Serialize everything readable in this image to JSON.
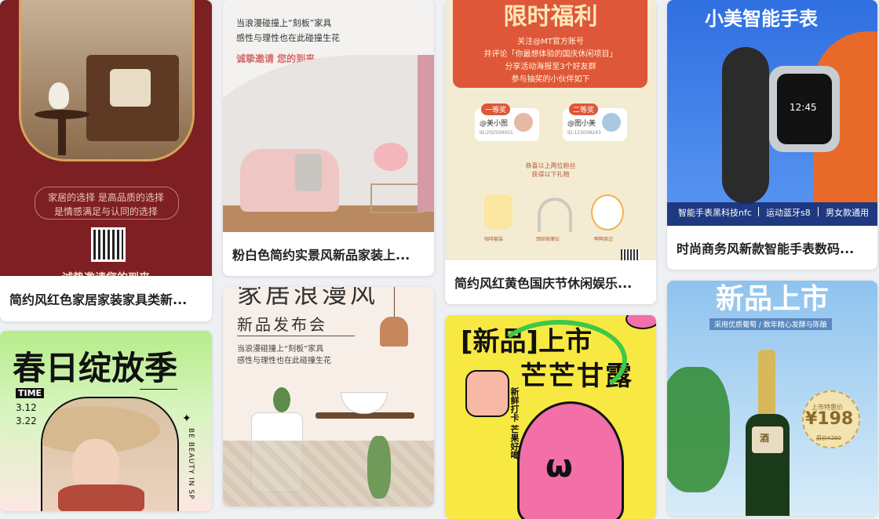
{
  "cards": [
    {
      "title": "简约风红色家居家装家具类新...",
      "lines": [
        "家居的选择 是高品质的选择",
        "是情感满足与认同的选择"
      ],
      "footer": "诚挚邀请您的到来"
    },
    {
      "title": "春日绽放季",
      "tag": "TIME",
      "dates": [
        "3.12",
        "3.22"
      ],
      "side": "BE BEAUTY IN SP"
    },
    {
      "title": "粉白色简约实景风新品家装上...",
      "lines": [
        "当浪漫碰撞上“刻板”家具",
        "感性与理性也在此碰撞生花"
      ],
      "invite": "诚挚邀请 您的到来"
    },
    {
      "heading": "家居浪漫风",
      "sub": "新品发布会",
      "lines": [
        "当浪漫碰撞上“刻板”家具",
        "感性与理性也在此碰撞生花"
      ]
    },
    {
      "title": "简约风红黄色国庆节休闲娱乐...",
      "heading": "限时福利",
      "rules": [
        "关注@MT官方账号",
        "并评论「你最想体验的国庆休闲项目」",
        "分享活动海报至3个好友群",
        "参与抽奖的小伙伴如下"
      ],
      "prize1": "一等奖",
      "prize2": "二等奖",
      "winner1": "@美小图",
      "winner2": "@图小美",
      "id1": "ID:202509001",
      "id2": "ID:123008243",
      "congrats": [
        "恭喜以上两位粉丝",
        "获得以下礼物"
      ],
      "gifts": [
        "咖啡套装",
        "颈部按摩仪",
        "鸭鸭周边"
      ]
    },
    {
      "heading1": "[新品]上市",
      "heading2": "芒芒甘露",
      "side": "新鲜打卡 芒果好喝"
    },
    {
      "title": "时尚商务风新款智能手表数码...",
      "heading": "小美智能手表",
      "features": [
        "智能手表黑科技nfc",
        "运动蓝牙s8",
        "男女款通用"
      ],
      "watch_time": "12:45"
    },
    {
      "heading": "新品上市",
      "sub": "采用优质葡萄 / 数年精心发酵与陈酿",
      "price_label": "上市特惠价",
      "price": "¥198",
      "orig": "原价¥290",
      "badge": "酒"
    }
  ]
}
